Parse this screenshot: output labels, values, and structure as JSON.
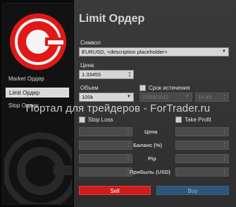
{
  "sidebar": {
    "items": [
      {
        "label": "Market Ордер"
      },
      {
        "label": "Limit Ордер"
      },
      {
        "label": "Stop Ордер"
      }
    ]
  },
  "form": {
    "title": "Limit Ордер",
    "symbol_label": "Символ",
    "symbol_value": "EURUSD, <description placeholder>",
    "price_label": "Цена",
    "price_value": "1.33455",
    "volume_label": "Объем",
    "volume_value": "100k",
    "expiry_label": "Срок истечения",
    "expiry_date": "27/03/2012",
    "expiry_time": "14:49",
    "stop_loss_label": "Stop Loss",
    "take_profit_label": "Take Profit",
    "sl_tp_rows": [
      "Цена",
      "Баланс (%)",
      "Pip",
      "Прибыль (USD)"
    ],
    "sell_label": "Sell",
    "buy_label": "Buy"
  },
  "watermark": "Портал для трейдеров - ForTrader.ru",
  "colors": {
    "sell": "#d11c1c",
    "buy": "#2e567a",
    "logo_red": "#e01818"
  }
}
